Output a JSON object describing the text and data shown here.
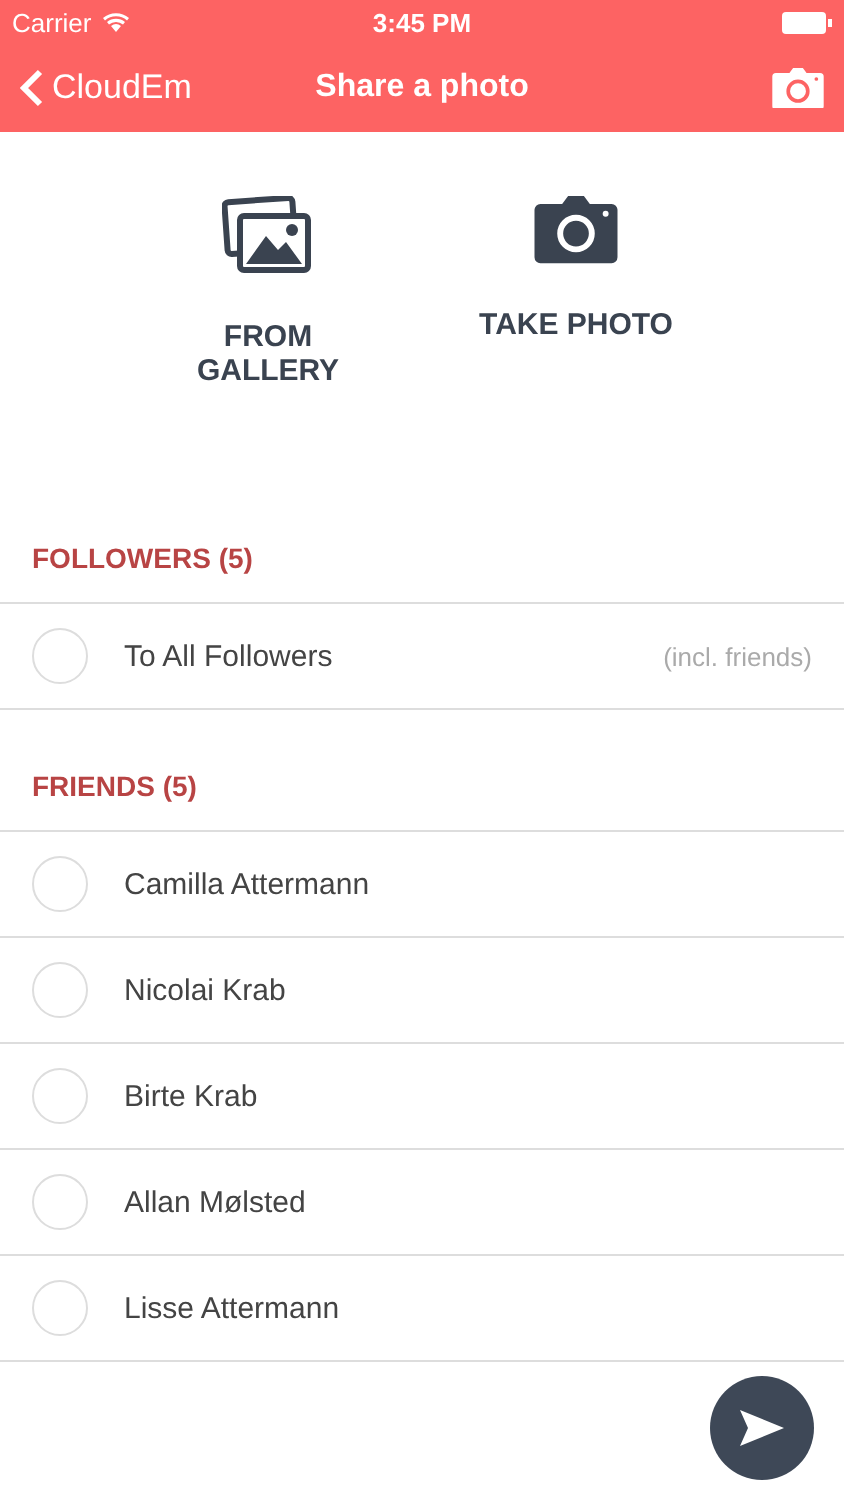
{
  "status_bar": {
    "carrier": "Carrier",
    "time": "3:45 PM"
  },
  "nav_bar": {
    "back_label": "CloudEm",
    "title": "Share a photo"
  },
  "sources": [
    {
      "kind": "gallery",
      "label": "FROM GALLERY"
    },
    {
      "kind": "camera",
      "label": "TAKE PHOTO"
    }
  ],
  "sections": [
    {
      "title": "FOLLOWERS (5)",
      "items": [
        {
          "name": "To All Followers",
          "note": "(incl. friends)",
          "selected": false
        }
      ]
    },
    {
      "title": "FRIENDS (5)",
      "items": [
        {
          "name": "Camilla Attermann",
          "selected": false
        },
        {
          "name": "Nicolai Krab",
          "selected": false
        },
        {
          "name": "Birte Krab",
          "selected": false
        },
        {
          "name": "Allan Mølsted",
          "selected": false
        },
        {
          "name": "Lisse Attermann",
          "selected": false
        }
      ]
    }
  ]
}
